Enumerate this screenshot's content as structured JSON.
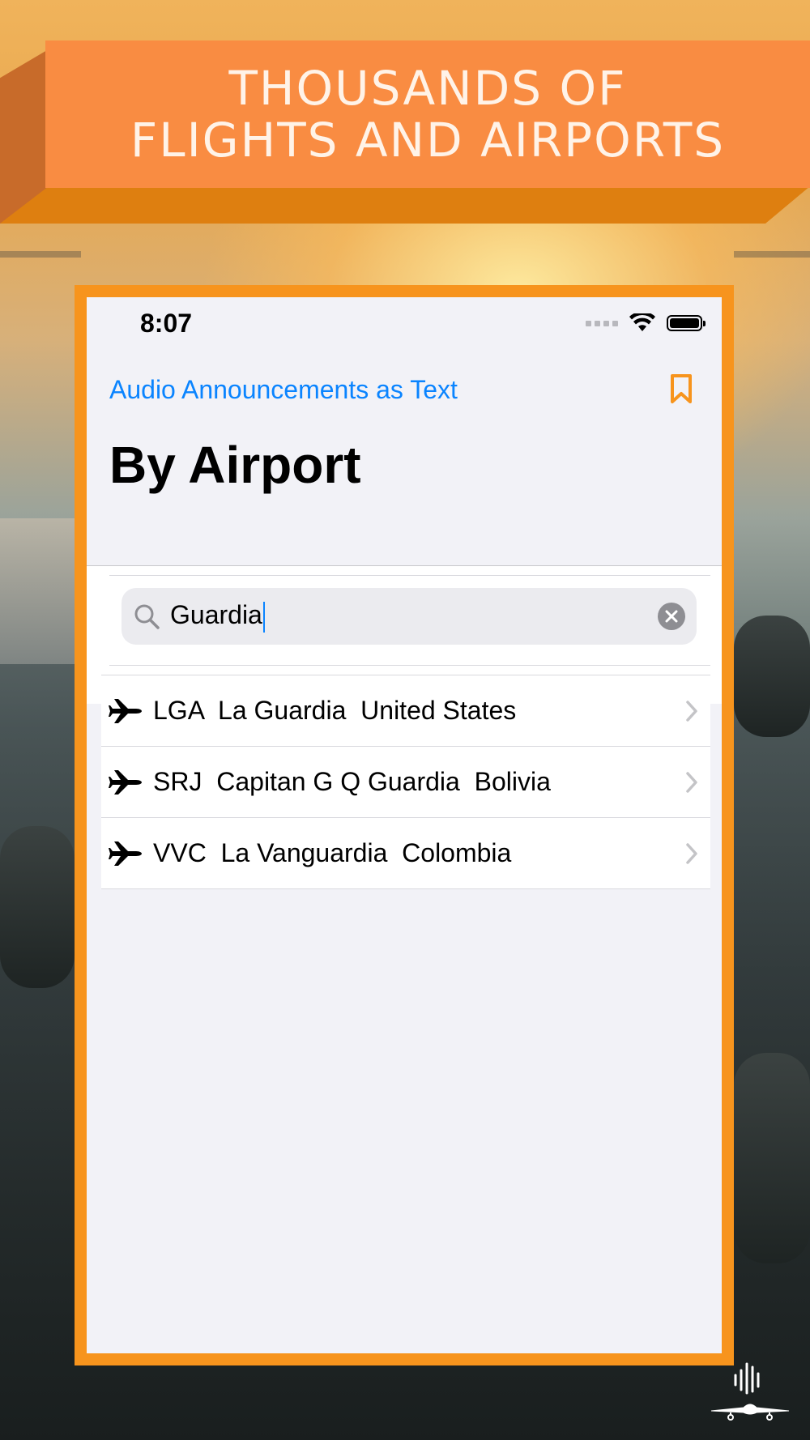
{
  "banner": {
    "line1": "THOUSANDS OF",
    "line2": "FLIGHTS AND AIRPORTS"
  },
  "status_bar": {
    "time": "8:07"
  },
  "nav": {
    "back_label": "Audio Announcements as Text",
    "bookmark_icon": "bookmark-icon",
    "title": "By Airport"
  },
  "search": {
    "value": "Guardia",
    "search_icon": "search-icon",
    "clear_icon": "clear-icon"
  },
  "results": [
    {
      "text": "LGA  La Guardia  United States",
      "icon": "airplane-icon"
    },
    {
      "text": "SRJ  Capitan G Q Guardia  Bolivia",
      "icon": "airplane-icon"
    },
    {
      "text": "VVC  La Vanguardia  Colombia",
      "icon": "airplane-icon"
    }
  ],
  "colors": {
    "accent": "#0a84ff",
    "frame": "#f7941d",
    "banner": "#f98c42",
    "bookmark": "#f7941d"
  }
}
